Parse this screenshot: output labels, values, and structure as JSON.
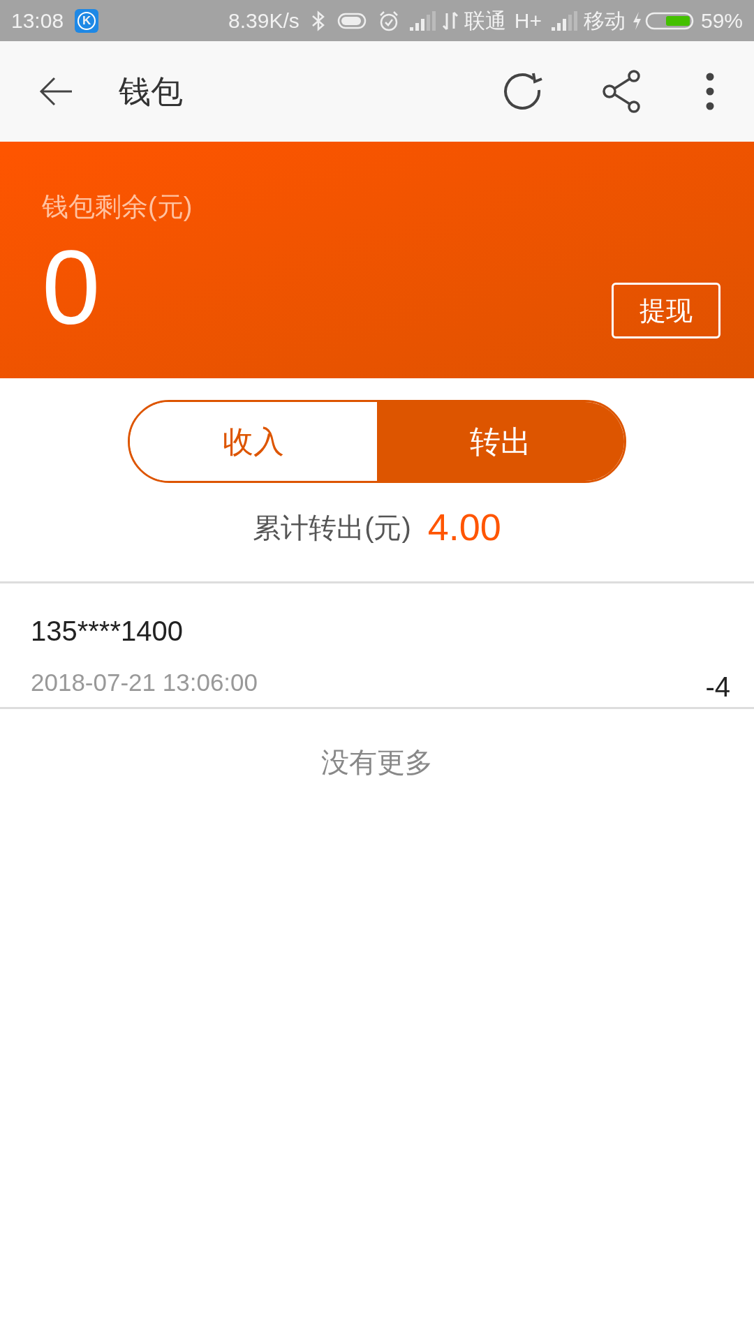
{
  "status_bar": {
    "time": "13:08",
    "app_badge": "K",
    "speed": "8.39K/s",
    "carrier_1": "联通",
    "network_1": "H+",
    "carrier_2": "移动",
    "battery": "59%"
  },
  "app_bar": {
    "title": "钱包"
  },
  "balance": {
    "label": "钱包剩余(元)",
    "amount": "0",
    "withdraw_button": "提现"
  },
  "tabs": [
    {
      "label": "收入",
      "selected": false
    },
    {
      "label": "转出",
      "selected": true
    }
  ],
  "summary": {
    "label": "累计转出(元)",
    "value": "4.00"
  },
  "records": [
    {
      "account": "135****1400",
      "time": "2018-07-21 13:06:00",
      "amount": "-4"
    }
  ],
  "footer": "没有更多"
}
